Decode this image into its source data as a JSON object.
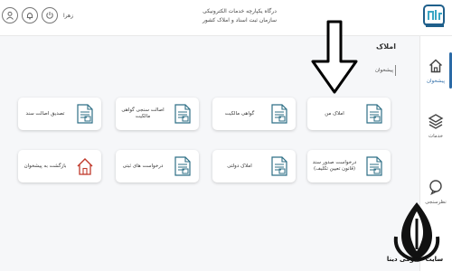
{
  "header": {
    "title_line1": "درگاه یکپارچه خدمات الکترونیکی",
    "title_line2": "سازمان ثبت اسناد و املاک کشور",
    "user_name": "زهرا"
  },
  "sidebar": {
    "items": [
      {
        "label": "پیشخوان",
        "icon": "home-icon"
      },
      {
        "label": "خدمات",
        "icon": "layers-icon"
      },
      {
        "label": "نظرسنجی",
        "icon": "chat-icon"
      }
    ]
  },
  "page": {
    "title": "املاک",
    "breadcrumb": "پیشخوان"
  },
  "cards": [
    {
      "label": "املاک من",
      "icon": "document-icon"
    },
    {
      "label": "گواهی مالکیت",
      "icon": "document-icon"
    },
    {
      "label": "اصالت سنجی گواهی مالکیت",
      "icon": "document-icon"
    },
    {
      "label": "تصدیق اصالت سند",
      "icon": "document-icon"
    },
    {
      "label": "درخواست صدور سند (قانون تعیین تکلیف)",
      "icon": "document-icon"
    },
    {
      "label": "املاک دولتی",
      "icon": "document-icon"
    },
    {
      "label": "درخواست های ثبتی",
      "icon": "document-icon"
    },
    {
      "label": "بازگشت به پیشخوان",
      "icon": "house-icon"
    }
  ],
  "watermark": {
    "text": "سایت حقوقی دینا"
  },
  "colors": {
    "accent": "#2b6aa6",
    "card_icon": "#2e6f86",
    "house_icon": "#c0392b"
  }
}
